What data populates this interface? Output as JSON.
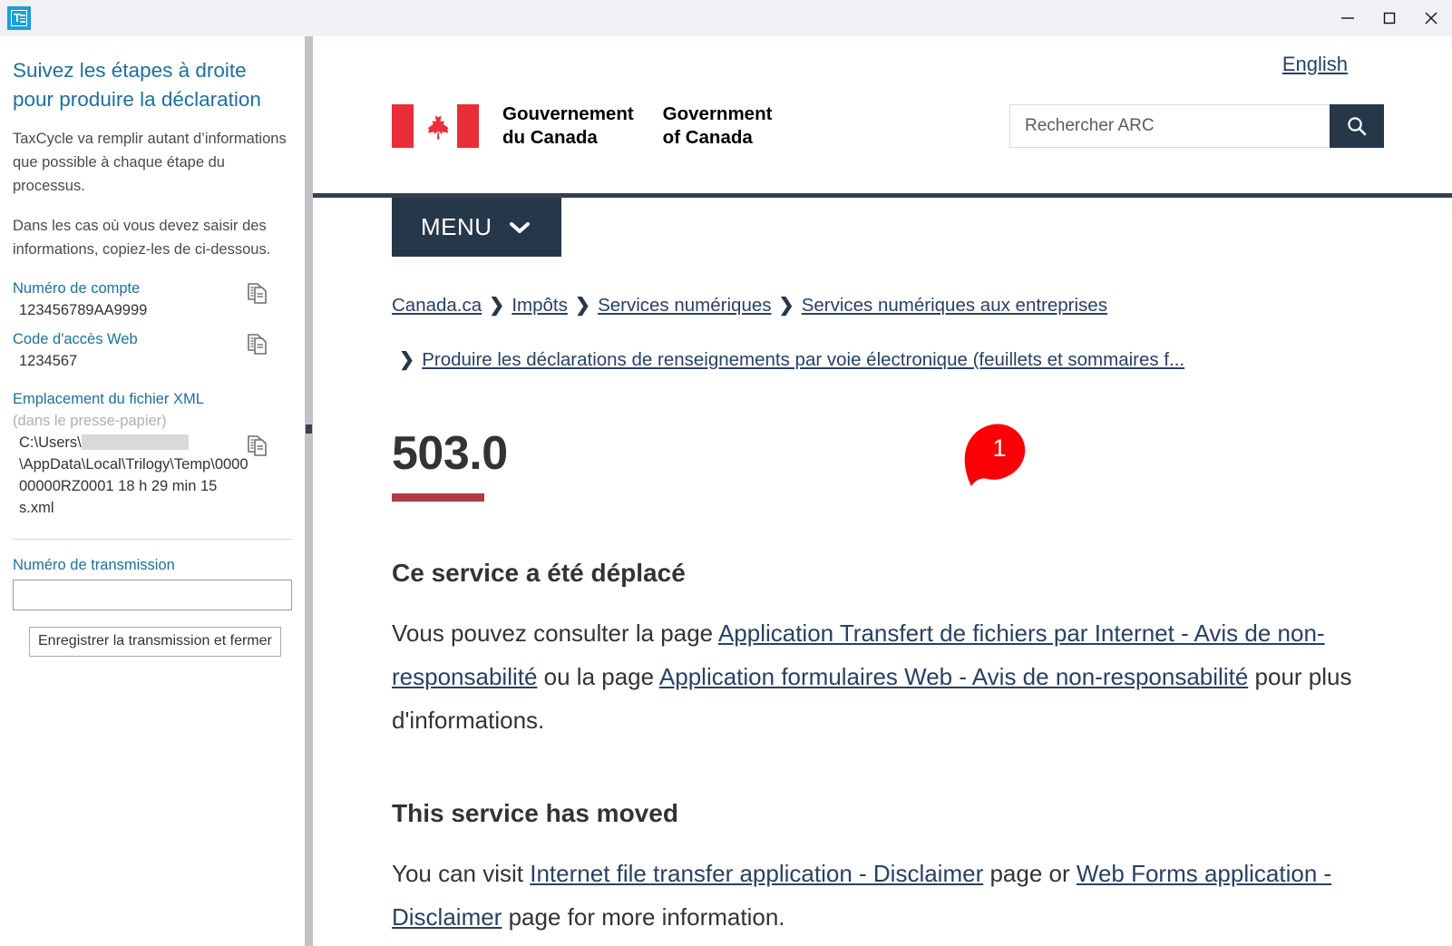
{
  "window": {
    "app_icon": "taxcycle-icon",
    "minimize": "minimize-icon",
    "maximize": "maximize-icon",
    "close": "close-icon"
  },
  "sidebar": {
    "title": "Suivez les étapes à droite pour produire la déclaration",
    "paragraphs": [
      "TaxCycle va remplir autant d’informations que possible à chaque étape du processus.",
      "Dans les cas où vous devez saisir des informations, copiez-les de ci-dessous."
    ],
    "fields": [
      {
        "label": "Numéro de compte",
        "value": "123456789AA9999",
        "copy_icon": "copy-icon"
      },
      {
        "label": "Code d'accès Web",
        "value": "1234567",
        "copy_icon": "copy-icon"
      }
    ],
    "xml_field": {
      "label": "Emplacement du fichier XML",
      "sublabel": "(dans le presse-papier)",
      "value_prefix": "C:\\Users\\",
      "value_redacted": "",
      "value_rest": "\\AppData\\Local\\Trilogy\\Temp\\000000000RZ0001 18 h 29 min 15 s.xml",
      "copy_icon": "copy-icon"
    },
    "transmission": {
      "label": "Numéro de transmission",
      "value": "",
      "placeholder": ""
    },
    "save_button": "Enregistrer la transmission et fermer"
  },
  "header": {
    "english_link": "English",
    "brand_fr_line1": "Gouvernement",
    "brand_fr_line2": "du Canada",
    "brand_en_line1": "Government",
    "brand_en_line2": "of Canada",
    "search_placeholder": "Rechercher ARC",
    "search_value": "",
    "search_icon": "search-icon",
    "menu_label": "MENU",
    "menu_chevron": "chevron-down-icon"
  },
  "breadcrumb": {
    "separator": "❯",
    "items_line1": [
      "Canada.ca",
      "Impôts",
      "Services numériques",
      "Services numériques aux entreprises"
    ],
    "item_line2": "Produire les déclarations de renseignements par voie électronique (feuillets et sommaires f..."
  },
  "main": {
    "page_title": "503.0",
    "fr": {
      "heading": "Ce service a été déplacé",
      "text_1": "Vous pouvez consulter la page ",
      "link_1": "Application Transfert de fichiers par Internet - Avis de non-responsabilité",
      "text_2": " ou la page ",
      "link_2": "Application formulaires Web - Avis de non-responsabilité",
      "text_3": " pour plus d'informations."
    },
    "en": {
      "heading": "This service has moved",
      "text_1": "You can visit ",
      "link_1": "Internet file transfer application - Disclaimer",
      "text_2": " page or ",
      "link_2": "Web Forms application - Disclaimer",
      "text_3": " page for more information."
    },
    "marker": {
      "label": "1",
      "color": "#fb0007"
    }
  },
  "colors": {
    "accent_blue": "#1f6f9a",
    "gc_navy": "#26374a",
    "gc_red": "#af3c43",
    "flag_red": "#ea2d37",
    "link_navy": "#284162",
    "titlebar": "#f2eff6"
  }
}
